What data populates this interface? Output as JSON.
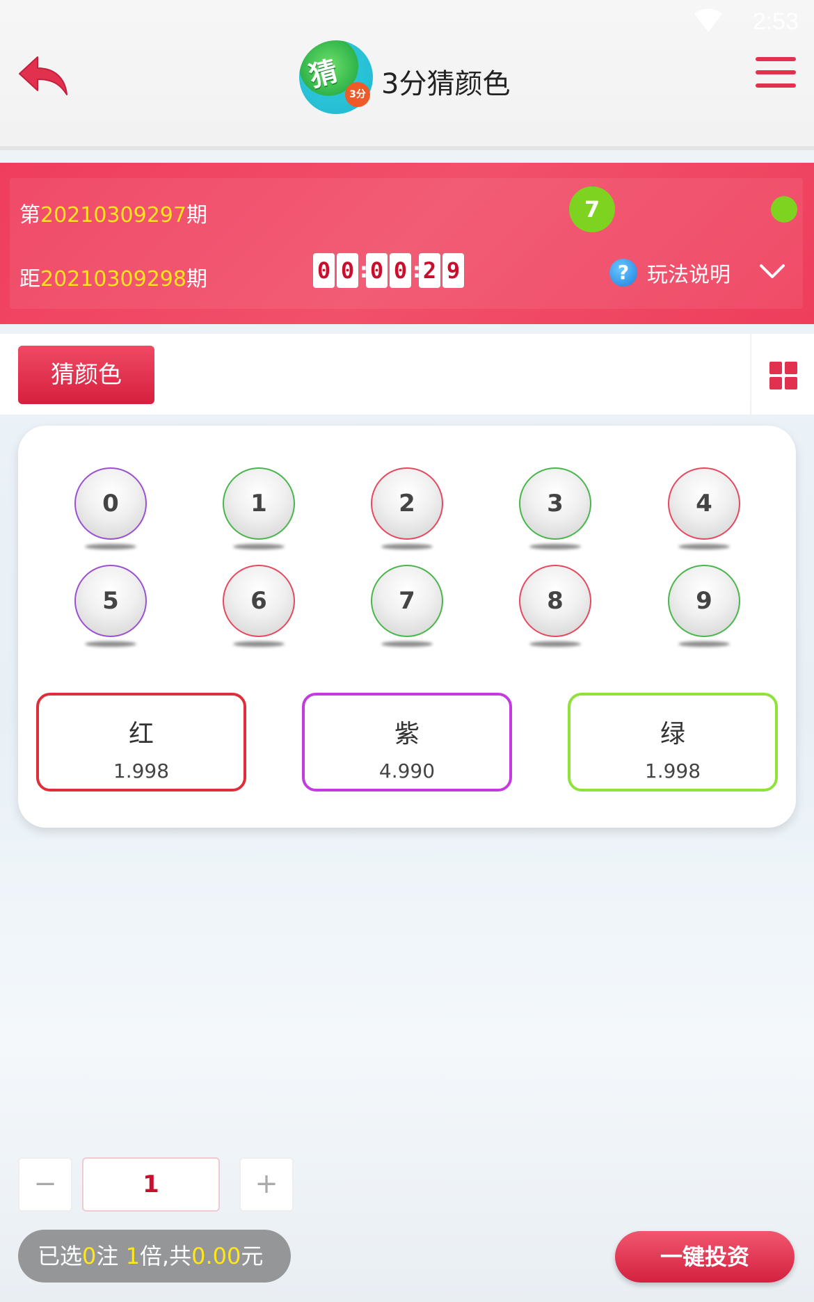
{
  "status_bar": {
    "time": "2:53"
  },
  "header": {
    "title": "3分猜颜色",
    "logo_char": "猜",
    "logo_badge": "3分"
  },
  "info": {
    "current_prefix": "第",
    "current_period": "20210309297",
    "current_suffix": "期",
    "next_prefix": "距",
    "next_period": "20210309298",
    "next_suffix": "期",
    "result_number": "7",
    "result_color": "#7ed321",
    "countdown": [
      "0",
      "0",
      "0",
      "0",
      "2",
      "9"
    ],
    "help_label": "玩法说明"
  },
  "tab": {
    "active_label": "猜颜色"
  },
  "balls": [
    {
      "n": "0",
      "color": "purple"
    },
    {
      "n": "1",
      "color": "green"
    },
    {
      "n": "2",
      "color": "red"
    },
    {
      "n": "3",
      "color": "green"
    },
    {
      "n": "4",
      "color": "red"
    },
    {
      "n": "5",
      "color": "purple"
    },
    {
      "n": "6",
      "color": "red"
    },
    {
      "n": "7",
      "color": "green"
    },
    {
      "n": "8",
      "color": "red"
    },
    {
      "n": "9",
      "color": "green"
    }
  ],
  "colors": [
    {
      "name": "红",
      "odds": "1.998",
      "border": "#e02d3a"
    },
    {
      "name": "紫",
      "odds": "4.990",
      "border": "#c33ae0"
    },
    {
      "name": "绿",
      "odds": "1.998",
      "border": "#8fe23a"
    }
  ],
  "bottom": {
    "multiplier": "1",
    "minus": "−",
    "plus": "+",
    "summary_prefix": "已选",
    "selected_count": "0",
    "summary_mid1": "注 ",
    "multiple": "1",
    "summary_mid2": "倍,共",
    "total": "0.00",
    "summary_suffix": "元",
    "submit_label": "一键投资"
  }
}
